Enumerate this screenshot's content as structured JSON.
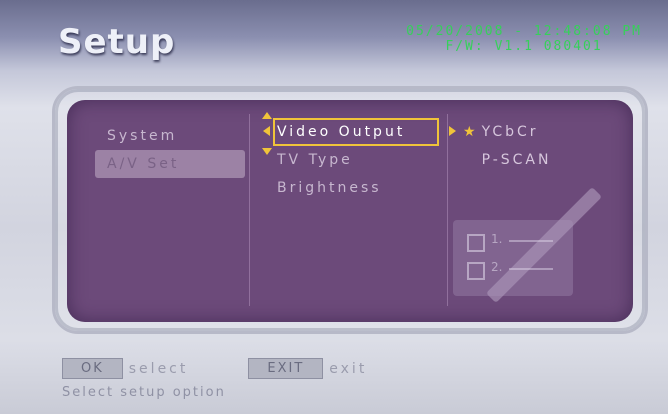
{
  "header": {
    "title": "Setup",
    "datetime": "05/20/2008 - 12:48:08 PM",
    "firmware": "F/W: V1.1 080401"
  },
  "menu": {
    "level1": [
      {
        "label": "System",
        "selected": false
      },
      {
        "label": "A/V Set",
        "selected": true
      }
    ],
    "level2": [
      {
        "label": "Video Output",
        "selected": true
      },
      {
        "label": "TV Type",
        "selected": false
      },
      {
        "label": "Brightness",
        "selected": false
      }
    ],
    "level3": [
      {
        "label": "YCbCr",
        "current": true
      },
      {
        "label": "P-SCAN",
        "current": false
      }
    ]
  },
  "deco": {
    "items": [
      "1.",
      "2."
    ]
  },
  "footer": {
    "ok_label": "OK",
    "ok_action": "select",
    "exit_label": "EXIT",
    "exit_action": "exit",
    "hint": "Select setup option"
  },
  "colors": {
    "accent": "#f0c43a",
    "panel": "#6c4a7a",
    "datetime": "#36d05a"
  }
}
